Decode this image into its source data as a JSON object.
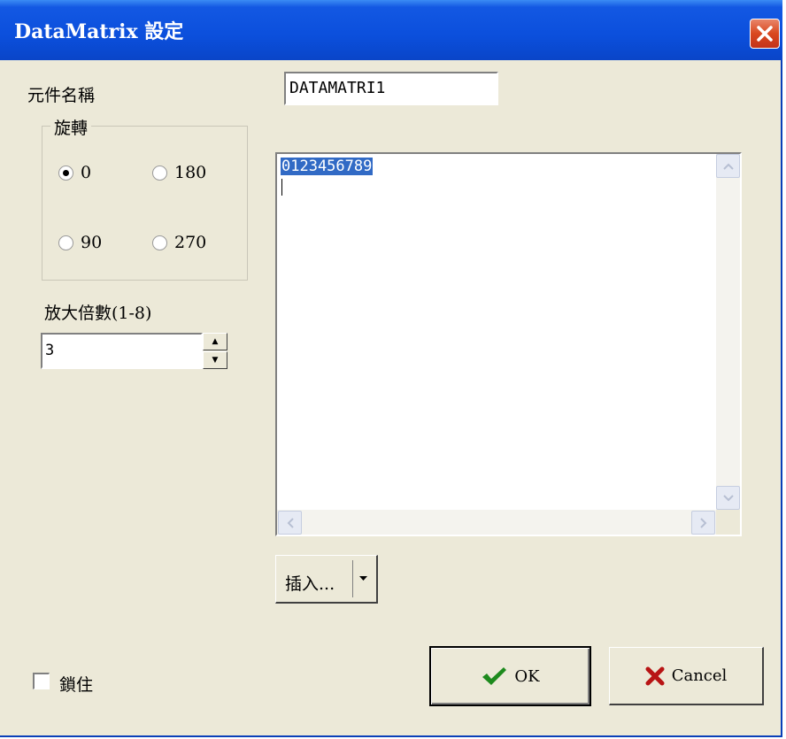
{
  "window": {
    "title": "DataMatrix 設定",
    "title_bar_color": "#0a4fdc",
    "face_color": "#ece9d8",
    "close_icon": "close-icon"
  },
  "component_name": {
    "label": "元件名稱",
    "value": "DATAMATRI1"
  },
  "rotation": {
    "group_label": "旋轉",
    "options": [
      {
        "label": "0",
        "checked": true
      },
      {
        "label": "180",
        "checked": false
      },
      {
        "label": "90",
        "checked": false
      },
      {
        "label": "270",
        "checked": false
      }
    ]
  },
  "magnification": {
    "label": "放大倍數(1-8)",
    "value": "3"
  },
  "content": {
    "text": "0123456789",
    "selection_color": "#316ac5"
  },
  "insert": {
    "label": "插入..."
  },
  "lock": {
    "label": "鎖住",
    "checked": false
  },
  "buttons": {
    "ok_label": "OK",
    "ok_icon": "checkmark-icon",
    "cancel_label": "Cancel",
    "cancel_icon": "x-cross-icon"
  }
}
